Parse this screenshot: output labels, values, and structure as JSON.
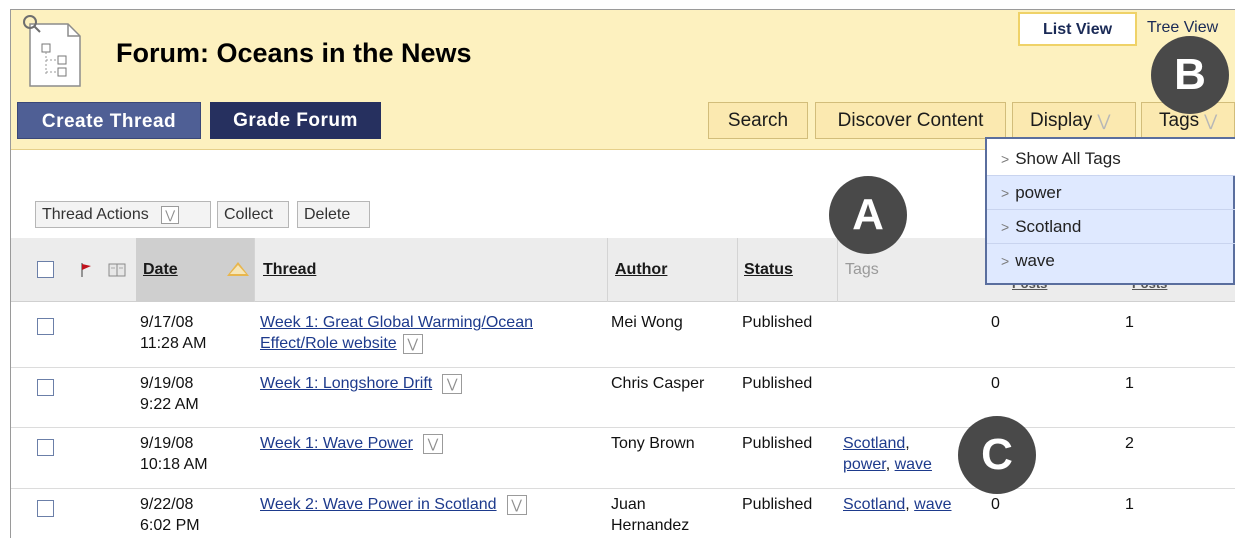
{
  "forum": {
    "title": "Forum: Oceans in the News"
  },
  "view": {
    "list": "List View",
    "tree": "Tree View"
  },
  "toolbar": {
    "create_thread": "Create Thread",
    "grade_forum": "Grade Forum",
    "search": "Search",
    "discover": "Discover Content",
    "display": "Display",
    "tags": "Tags"
  },
  "tags_menu": [
    "Show All Tags",
    "power",
    "Scotland",
    "wave"
  ],
  "actions": {
    "thread_actions": "Thread Actions",
    "collect": "Collect",
    "delete": "Delete"
  },
  "columns": {
    "date": "Date",
    "thread": "Thread",
    "author": "Author",
    "status": "Status",
    "tags": "Tags",
    "col6": "Posts",
    "col7": "Posts"
  },
  "badges": {
    "a": "A",
    "b": "B",
    "c": "C"
  },
  "rows": [
    {
      "date": "9/17/08",
      "time": "11:28 AM",
      "thread_line1": "Week 1: Great Global Warming/Ocean",
      "thread_line2": "Effect/Role website",
      "author_line1": "Mei Wong",
      "author_line2": "",
      "status": "Published",
      "tags_line1": "",
      "tags_line2": "",
      "c1": "0",
      "c2": "1"
    },
    {
      "date": "9/19/08",
      "time": "9:22 AM",
      "thread_line1": "Week 1: Longshore Drift",
      "thread_line2": "",
      "author_line1": "Chris Casper",
      "author_line2": "",
      "status": "Published",
      "tags_line1": "",
      "tags_line2": "",
      "c1": "0",
      "c2": "1"
    },
    {
      "date": "9/19/08",
      "time": "10:18 AM",
      "thread_line1": "Week 1: Wave Power",
      "thread_line2": "",
      "author_line1": "Tony Brown",
      "author_line2": "",
      "status": "Published",
      "tags_line1": "Scotland,",
      "tags_line2": "power, wave",
      "c1": "",
      "c2": "2"
    },
    {
      "date": "9/22/08",
      "time": "6:02 PM",
      "thread_line1": "Week 2: Wave Power in Scotland",
      "thread_line2": "",
      "author_line1": "Juan",
      "author_line2": "Hernandez",
      "status": "Published",
      "tags_line1": "Scotland, wave",
      "tags_line2": "",
      "c1": "0",
      "c2": "1"
    }
  ]
}
